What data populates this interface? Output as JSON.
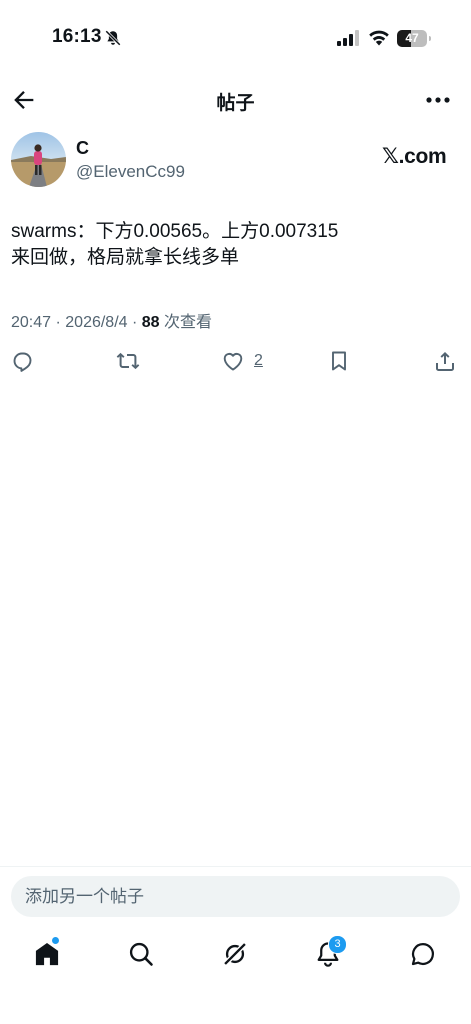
{
  "status_bar": {
    "time": "16:13",
    "battery_level": "47",
    "battery_fraction": 0.47
  },
  "header": {
    "title": "帖子",
    "back_icon": "arrow-left-icon",
    "more_icon": "more-horizontal-icon"
  },
  "post": {
    "author_name": "C",
    "author_handle": "@ElevenCc99",
    "source": "𝕏.com",
    "text": "swarms：下方0.00565。上方0.007315\n来回做，格局就拿长线多单",
    "meta": {
      "time": "20:47",
      "date": "2026/8/4",
      "separator": " · ",
      "views_count": "88",
      "views_label": " 次查看"
    },
    "actions": {
      "like_count": "2"
    }
  },
  "compose": {
    "placeholder": "添加另一个帖子"
  },
  "tabs": {
    "notifications_badge": "3"
  },
  "colors": {
    "text_primary": "#0f1419",
    "text_secondary": "#536471",
    "accent": "#1d9bf0",
    "input_bg": "#eff3f4"
  }
}
